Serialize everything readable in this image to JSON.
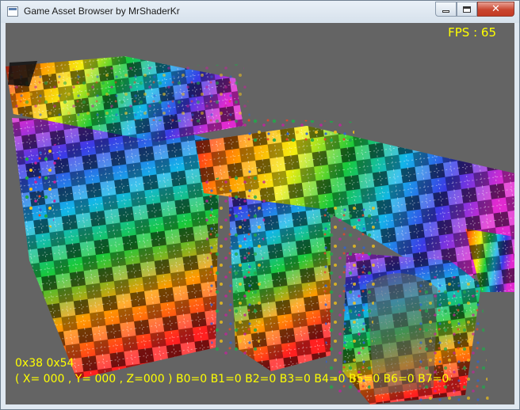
{
  "window": {
    "title": "Game Asset Browser by MrShaderKr",
    "icon": "app-window-icon",
    "controls": {
      "minimize": "minimize-icon",
      "maximize": "maximize-icon",
      "close": "✕"
    }
  },
  "viewport": {
    "background_color": "#646464",
    "scene": "rainbow checker-textured 3D level geometry",
    "fps_text": "FPS : 65",
    "hud_line1": "0x38 0x54",
    "hud_line2": "( X= 000 , Y= 000 , Z=000 ) B0=0 B1=0 B2=0 B3=0 B4=0 B5=0 B6=0 B7=0",
    "hud_color": "#ffff00"
  }
}
